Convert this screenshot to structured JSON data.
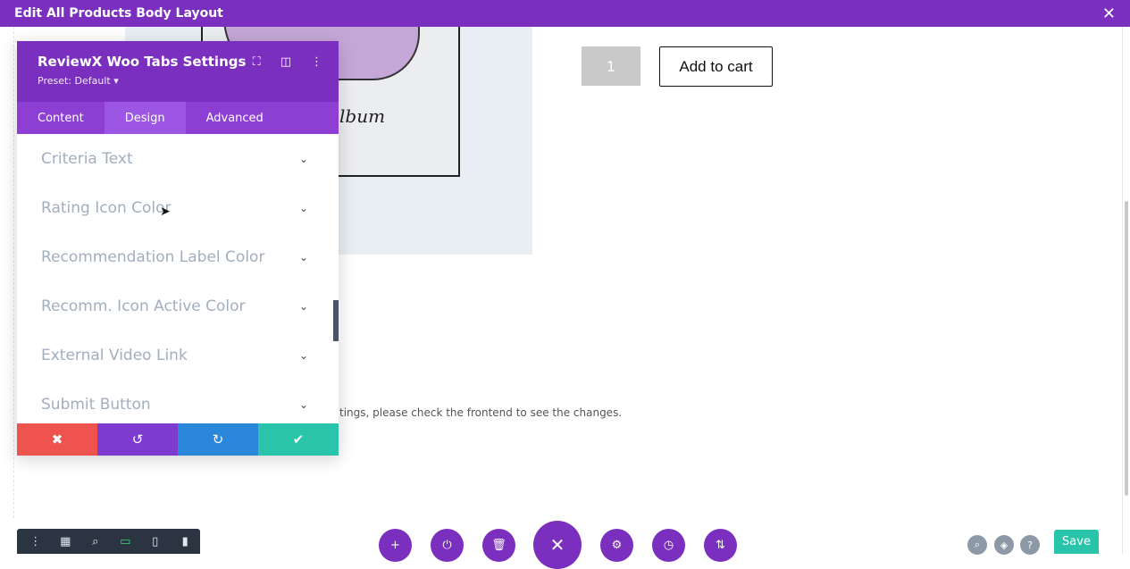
{
  "topbar": {
    "title": "Edit All Products Body Layout",
    "close_icon": "close-icon"
  },
  "product": {
    "sketch_text": "lbum",
    "quantity": "1",
    "add_to_cart": "Add to cart"
  },
  "notice": "tings, please check the frontend to see the changes.",
  "modal": {
    "title": "ReviewX Woo Tabs Settings",
    "preset": "Preset: Default ▾",
    "tabs": [
      {
        "label": "Content",
        "active": false
      },
      {
        "label": "Design",
        "active": true
      },
      {
        "label": "Advanced",
        "active": false
      }
    ],
    "rows": [
      "Criteria Text",
      "Rating Icon Color",
      "Recommendation Label Color",
      "Recomm. Icon Active Color",
      "External Video Link",
      "Submit Button"
    ]
  },
  "colors": {
    "brand_purple": "#7b2fbf",
    "cancel_red": "#ef5350",
    "redo_blue": "#2b87da",
    "save_green": "#29c4a9"
  }
}
